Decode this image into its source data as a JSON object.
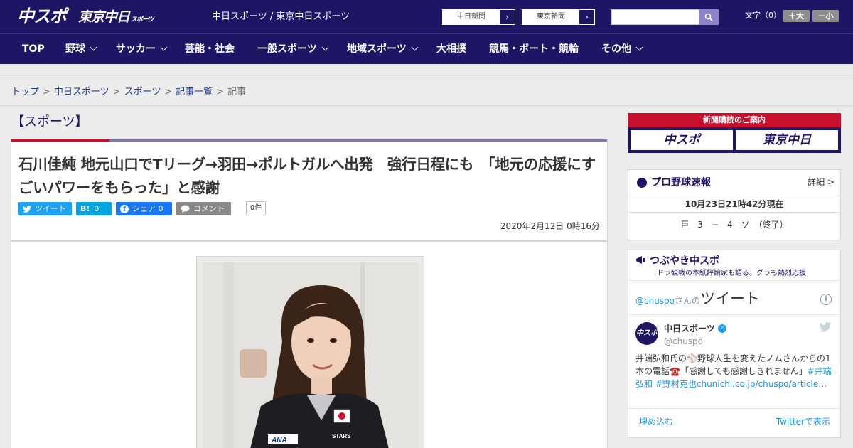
{
  "header": {
    "logo_chuspo": "中スポ",
    "logo_tokyo": "東京中日",
    "logo_tokyo_small": "スポーツ",
    "site_names": "中日スポーツ / 東京中日スポーツ",
    "paper_links": [
      "中日新聞",
      "東京新聞"
    ],
    "search": {
      "placeholder": "",
      "value": ""
    },
    "font_size_label": "文字（0）",
    "font_larger": "＋大",
    "font_smaller": "－小"
  },
  "nav": {
    "items": [
      {
        "label": "TOP",
        "dropdown": false
      },
      {
        "label": "野球",
        "dropdown": true
      },
      {
        "label": "サッカー",
        "dropdown": true
      },
      {
        "label": "芸能・社会",
        "dropdown": false
      },
      {
        "label": "一般スポーツ",
        "dropdown": true
      },
      {
        "label": "地域スポーツ",
        "dropdown": true
      },
      {
        "label": "大相撲",
        "dropdown": false
      },
      {
        "label": "競馬・ボート・競輪",
        "dropdown": false
      },
      {
        "label": "その他",
        "dropdown": true
      }
    ]
  },
  "breadcrumb": {
    "items": [
      "トップ",
      "中日スポーツ",
      "スポーツ",
      "記事一覧"
    ],
    "current": "記事",
    "separator": ">"
  },
  "article": {
    "section": "【スポーツ】",
    "headline": "石川佳純 地元山口でTリーグ→羽田→ポルトガルへ出発　強行日程にも　「地元の応援にすごいパワーをもらった」と感謝",
    "share": {
      "tweet": "ツイート",
      "hatena_icon": "B!",
      "hatena_count": "0",
      "facebook": "シェア 0",
      "comment": "コメント",
      "comment_count": "0件"
    },
    "date": "2020年2月12日 0時16分"
  },
  "sidebar": {
    "ad_title": "新聞購読のご案内",
    "ad_logos": [
      "中スポ",
      "東京中日"
    ],
    "baseball": {
      "title": "プロ野球速報",
      "detail": "詳細 >",
      "time": "10月23日21時42分現在",
      "score": "巨　3　−　4　ソ　（終了）"
    },
    "tweets": {
      "title": "つぶやき中スポ",
      "subtitle": "ドラ観戦の本紙評論家も語る。グラも熱烈応援",
      "handle_prefix": "@chuspo",
      "handle_suffix": "さんの",
      "heading": "ツイート",
      "info": "i",
      "account_name": "中日スポーツ",
      "account_handle": "@chuspo",
      "avatar_text": "中スポ",
      "tweet_text_1": "井端弘和氏の⚾野球人生を変えたノムさんからの1本の電話☎️「感謝しても感謝しきれません」",
      "tweet_link": "#井端弘和 #野村克也chunichi.co.jp/chuspo/article…",
      "embed": "埋め込む",
      "view": "Twitterで表示"
    }
  },
  "colors": {
    "brand": "#1f1565",
    "accent_red": "#c8102e",
    "twitter": "#1da1f2",
    "hatena": "#00a4de",
    "facebook": "#1877f2",
    "comment": "#888888"
  }
}
